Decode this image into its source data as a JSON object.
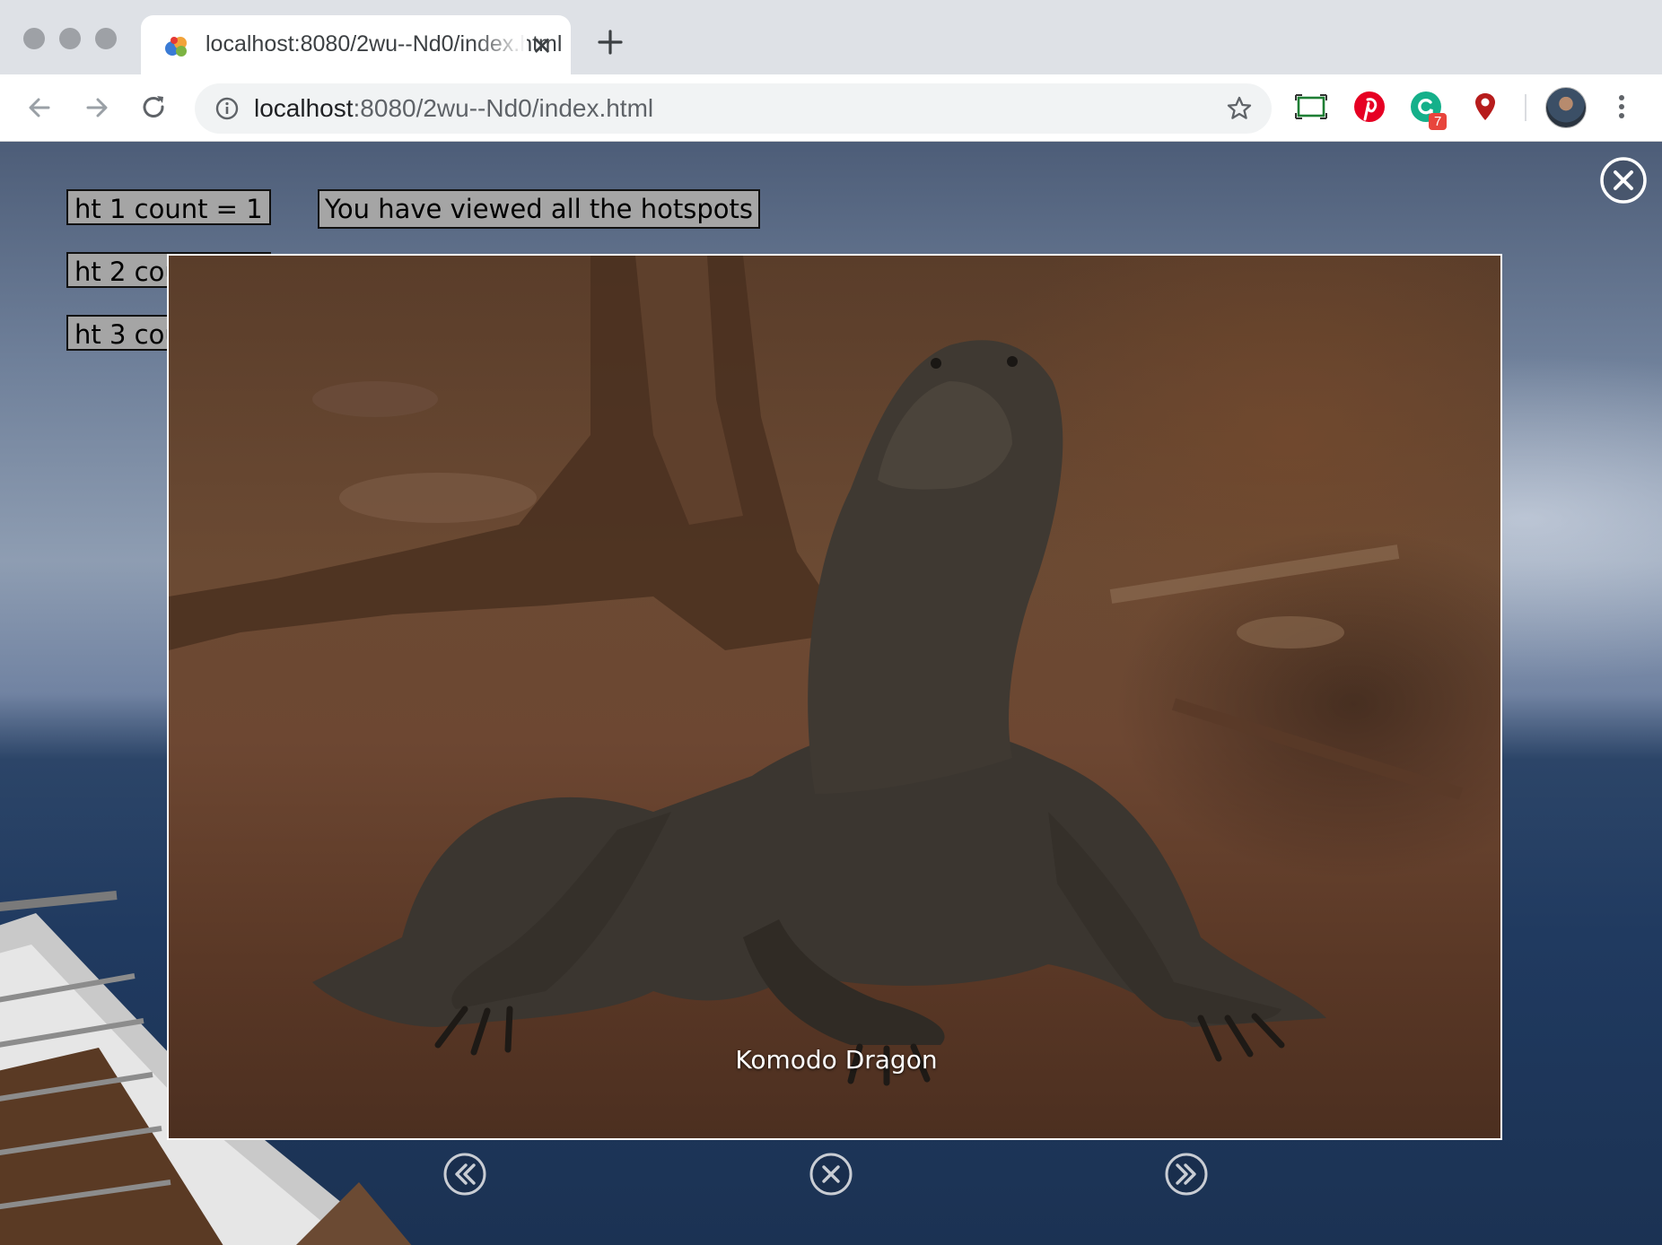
{
  "browser": {
    "tab_title": "localhost:8080/2wu--Nd0/index.html",
    "url_host": "localhost",
    "url_rest": ":8080/2wu--Nd0/index.html",
    "extension_badge": "7"
  },
  "hotspots": [
    {
      "label": "ht 1 count = 1"
    },
    {
      "label": "ht 2 count = 1"
    },
    {
      "label": "ht 3 count = 1"
    }
  ],
  "message": "You have viewed all the hotspots",
  "lightbox": {
    "caption": "Komodo Dragon"
  },
  "colors": {
    "hotspot_bg": "#a5a5a5",
    "lightbox_border": "#ffffff"
  }
}
